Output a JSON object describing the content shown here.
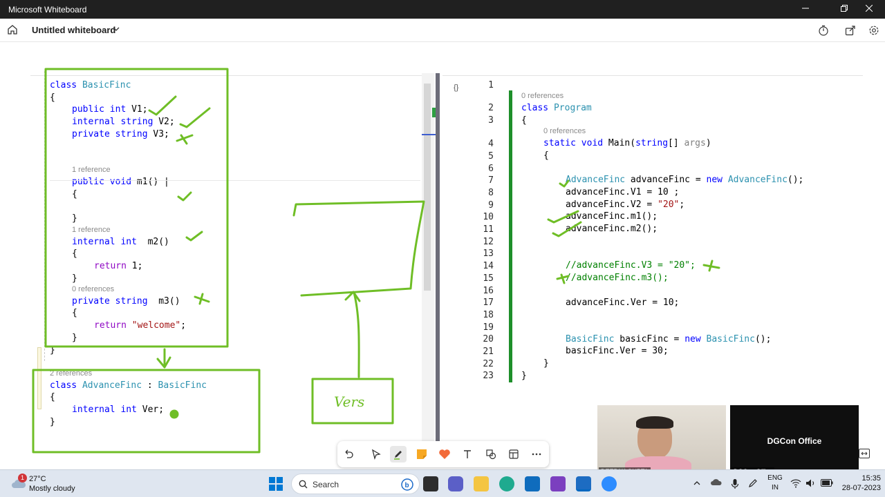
{
  "window": {
    "title": "Microsoft Whiteboard",
    "minimize_icon": "minimize-icon",
    "maximize_icon": "restore-icon",
    "close_icon": "close-icon"
  },
  "appbar": {
    "board_title": "Untitled whiteboard",
    "icons": [
      "home-icon",
      "chevron-down-icon",
      "timer-icon",
      "share-icon",
      "settings-icon"
    ]
  },
  "left_code": {
    "basic_refs": {
      "m1": "1 reference",
      "m2": "1 reference",
      "m3": "0 references"
    },
    "advance_refs": "2 references",
    "handwriting": "Vers"
  },
  "right_code": {
    "refs": {
      "program": "0 references",
      "main": "0 references"
    },
    "line_numbers": [
      "1",
      "2",
      "3",
      "4",
      "5",
      "6",
      "7",
      "8",
      "9",
      "10",
      "11",
      "12",
      "13",
      "14",
      "15",
      "16",
      "17",
      "18",
      "19",
      "20",
      "21",
      "22",
      "23"
    ]
  },
  "toolbar": {
    "tools": [
      "undo-icon",
      "select-icon",
      "pen-icon",
      "sticky-note-icon",
      "reaction-icon",
      "text-icon",
      "shapes-icon",
      "templates-icon",
      "more-icon"
    ]
  },
  "video": {
    "participant_name": "DEEPAK GUPTA",
    "office_tile_title": "DGCon Office",
    "office_tile_label": "DGCon Office"
  },
  "taskbar": {
    "weather_badge": "1",
    "temperature": "27°C",
    "weather_desc": "Mostly cloudy",
    "search_placeholder": "Search",
    "lang_top": "ENG",
    "lang_bottom": "IN",
    "time": "15:35",
    "date": "28-07-2023",
    "colors": {
      "accent": "#0067c0",
      "ink_green": "#6fbe26"
    }
  }
}
